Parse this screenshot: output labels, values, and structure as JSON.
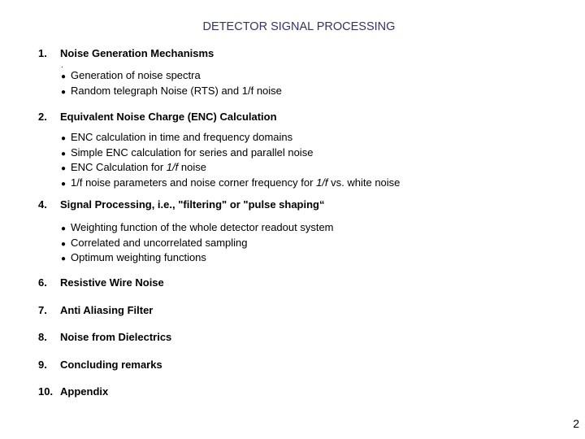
{
  "title": "DETECTOR SIGNAL PROCESSING",
  "sections": [
    {
      "number": "1.",
      "heading": "Noise Generation Mechanisms",
      "stray_mark": ".",
      "bullets": [
        {
          "pre": "Generation of noise spectra",
          "it": "",
          "post": ""
        },
        {
          "pre": "Random telegraph Noise (RTS) and 1/f noise",
          "it": "",
          "post": ""
        }
      ]
    },
    {
      "number": "2.",
      "heading": "Equivalent Noise Charge (ENC) Calculation",
      "bullets": [
        {
          "pre": "ENC calculation in time and frequency domains",
          "it": "",
          "post": ""
        },
        {
          "pre": "Simple ENC calculation for series and parallel noise",
          "it": "",
          "post": ""
        },
        {
          "pre": "ENC Calculation for ",
          "it": "1/f",
          "post": " noise"
        },
        {
          "pre": "1/f noise parameters and noise corner frequency for ",
          "it": "1/f",
          "post": " vs. white noise"
        }
      ]
    },
    {
      "number": "4.",
      "heading": "Signal Processing, i.e., \"filtering\" or \"pulse shaping“",
      "bullets": [
        {
          "pre": "Weighting function of the whole detector readout system",
          "it": "",
          "post": ""
        },
        {
          "pre": "Correlated and uncorrelated sampling",
          "it": "",
          "post": ""
        },
        {
          "pre": "Optimum weighting functions",
          "it": "",
          "post": ""
        }
      ]
    },
    {
      "number": "6.",
      "heading": "Resistive Wire Noise"
    },
    {
      "number": "7.",
      "heading": "Anti Aliasing Filter"
    },
    {
      "number": "8.",
      "heading": "Noise from Dielectrics"
    },
    {
      "number": "9.",
      "heading": "Concluding remarks"
    },
    {
      "number": "10.",
      "heading": "Appendix"
    }
  ],
  "bullet_glyph": "●",
  "page_number": "2",
  "colors": {
    "title": "#333366",
    "text": "#000000"
  }
}
